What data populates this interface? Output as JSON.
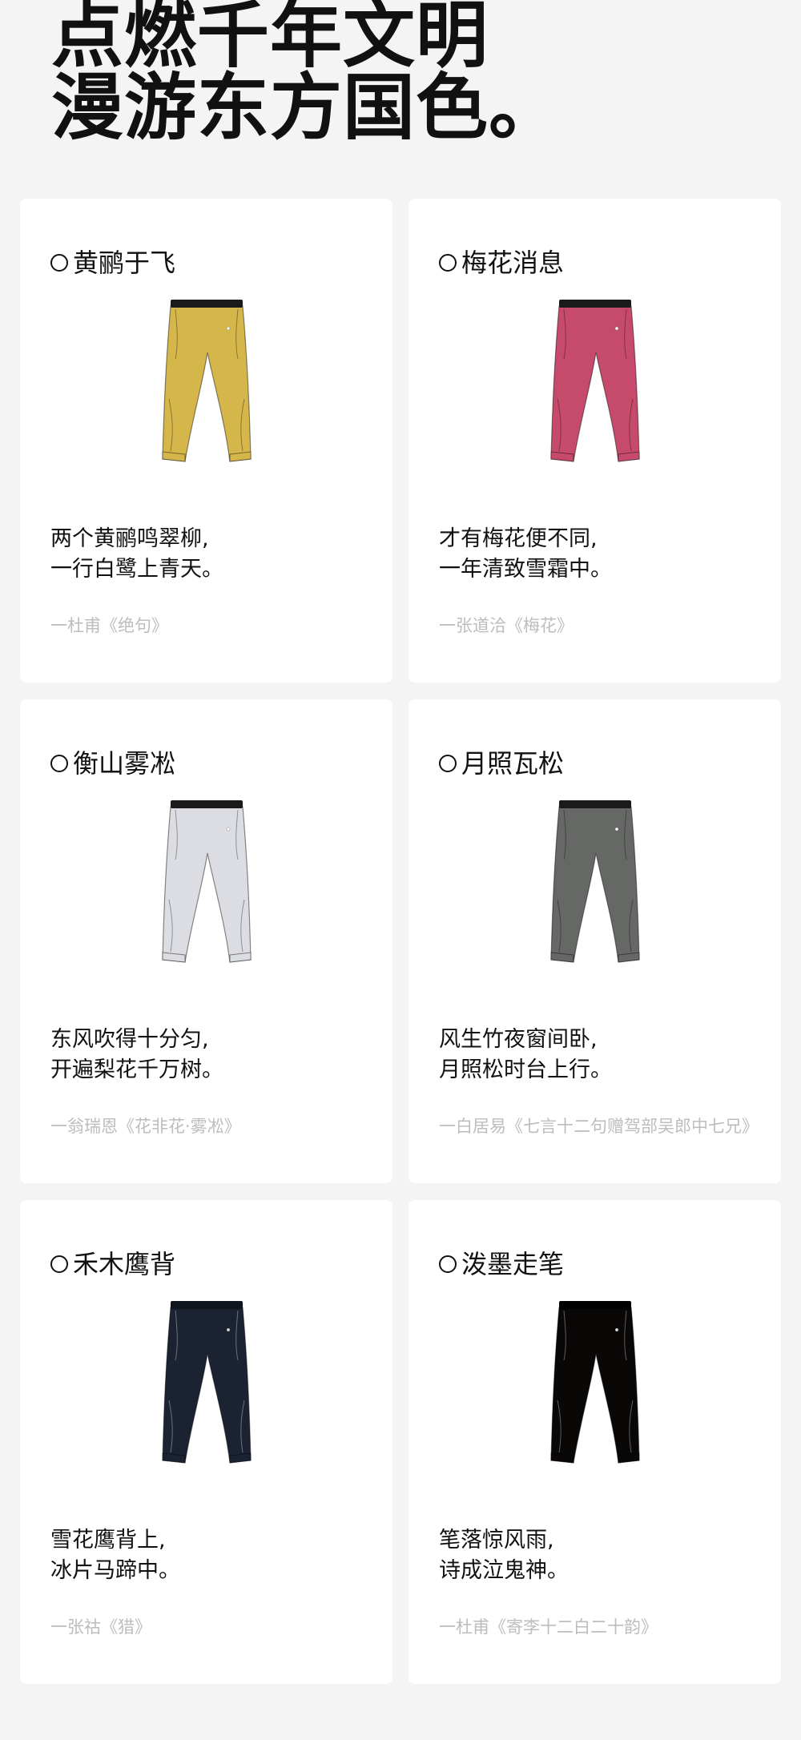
{
  "headline": {
    "line1": "点燃千年文明",
    "line2": "漫游东方国色。"
  },
  "cards": [
    {
      "title": "黄鹂于飞",
      "color": "#d4b64a",
      "waist": "#1a1a1a",
      "poem_line1": "两个黄鹂鸣翠柳,",
      "poem_line2": "一行白鹭上青天。",
      "source": "一杜甫《绝句》"
    },
    {
      "title": "梅花消息",
      "color": "#c64a6b",
      "waist": "#1a1a1a",
      "poem_line1": "才有梅花便不同,",
      "poem_line2": "一年清致雪霜中。",
      "source": "一张道洽《梅花》"
    },
    {
      "title": "衡山雾凇",
      "color": "#dcdde2",
      "waist": "#1a1a1a",
      "poem_line1": "东风吹得十分匀,",
      "poem_line2": "开遍梨花千万树。",
      "source": "一翁瑞恩《花非花·雾凇》"
    },
    {
      "title": "月照瓦松",
      "color": "#666866",
      "waist": "#1a1a1a",
      "poem_line1": "风生竹夜窗间卧,",
      "poem_line2": "月照松时台上行。",
      "source": "一白居易《七言十二句赠驾部吴郎中七兄》"
    },
    {
      "title": "禾木鹰背",
      "color": "#1b2333",
      "waist": "#10141c",
      "poem_line1": "雪花鹰背上,",
      "poem_line2": "冰片马蹄中。",
      "source": "一张祜《猎》"
    },
    {
      "title": "泼墨走笔",
      "color": "#0a0707",
      "waist": "#000000",
      "poem_line1": "笔落惊风雨,",
      "poem_line2": "诗成泣鬼神。",
      "source": "一杜甫《寄李十二白二十韵》"
    }
  ]
}
